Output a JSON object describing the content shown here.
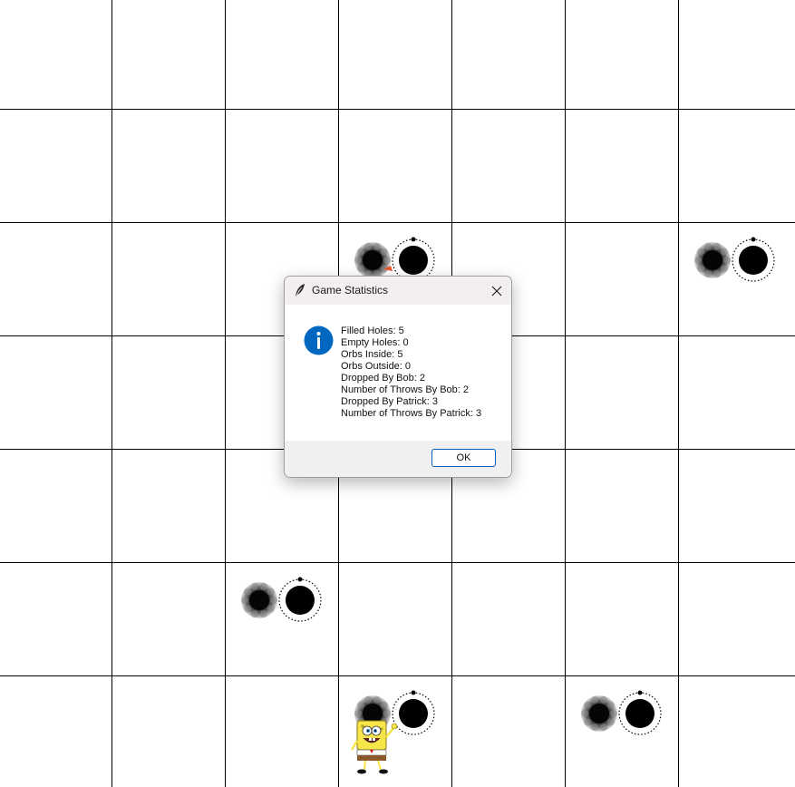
{
  "board": {
    "rows": 7,
    "columns": 7,
    "line_color": "#000000",
    "background": "#ffffff",
    "holes": [
      {
        "row": 2,
        "col": 3,
        "item": "orb",
        "state": "filled"
      },
      {
        "row": 2,
        "col": 6,
        "item": "orb",
        "state": "filled"
      },
      {
        "row": 5,
        "col": 2,
        "item": "orb",
        "state": "filled"
      },
      {
        "row": 6,
        "col": 3,
        "item": "orb",
        "state": "filled"
      },
      {
        "row": 6,
        "col": 5,
        "item": "orb",
        "state": "filled"
      }
    ],
    "character": {
      "name": "spongebob",
      "row": 6,
      "col": 3,
      "icon": "spongebob-character"
    },
    "partial_character": {
      "row": 2,
      "col": 3,
      "color": "#e85a2a"
    }
  },
  "dialog": {
    "title": "Game Statistics",
    "icon": "info-icon",
    "close_icon": "close-icon",
    "accent_color": "#0067c0",
    "lines": [
      "Filled Holes: 5",
      "Empty Holes: 0",
      "Orbs Inside: 5",
      "Orbs Outside: 0",
      "Dropped By Bob: 2",
      "Number of Throws By Bob: 2",
      "Dropped By Patrick: 3",
      "Number of Throws By Patrick: 3"
    ],
    "ok_label": "OK"
  }
}
